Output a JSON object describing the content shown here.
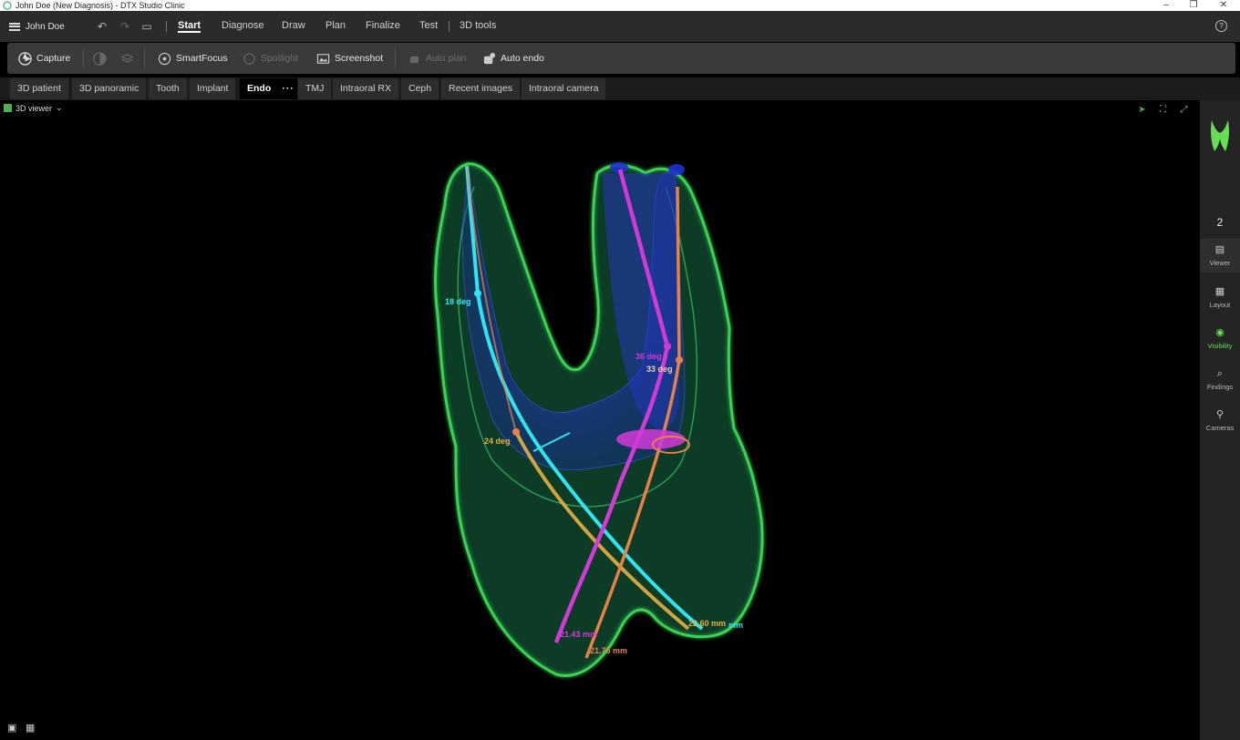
{
  "window": {
    "title": "John Doe (New Diagnosis) - DTX Studio Clinic"
  },
  "menu": {
    "user": "John Doe",
    "items": [
      "Start",
      "Diagnose",
      "Draw",
      "Plan",
      "Finalize",
      "Test",
      "3D tools"
    ],
    "active": "Start"
  },
  "toolbar": {
    "capture": "Capture",
    "smartfocus": "SmartFocus",
    "spotlight": "Spotlight",
    "screenshot": "Screenshot",
    "auto_plan": "Auto plan",
    "auto_endo": "Auto endo"
  },
  "tabs": [
    "3D patient",
    "3D panoramic",
    "Tooth",
    "Implant",
    "Endo",
    "TMJ",
    "Intraoral RX",
    "Ceph",
    "Recent images",
    "Intraoral camera"
  ],
  "active_tab": "Endo",
  "viewer": {
    "label": "3D viewer",
    "measurements": {
      "cyan_angle": "18 deg",
      "magenta_angle": "36 deg",
      "orange_angle": "33 deg",
      "yellow_angle": "24 deg",
      "magenta_length": "21.43 mm",
      "orange_length": "21.75 mm",
      "yellow_length": "22.60 mm",
      "cyan_length_suffix": "mm"
    }
  },
  "right_panel": {
    "tooth_number": "2",
    "items": [
      "Viewer",
      "Layout",
      "Visibility",
      "Findings",
      "Cameras"
    ],
    "active": "Visibility"
  },
  "colors": {
    "accent": "#66dd55",
    "tooth_outline": "#39d353",
    "canal_cyan": "#2ee6f0",
    "canal_magenta": "#d23ad8",
    "canal_orange": "#e8804a",
    "canal_yellow": "#e8b040"
  }
}
